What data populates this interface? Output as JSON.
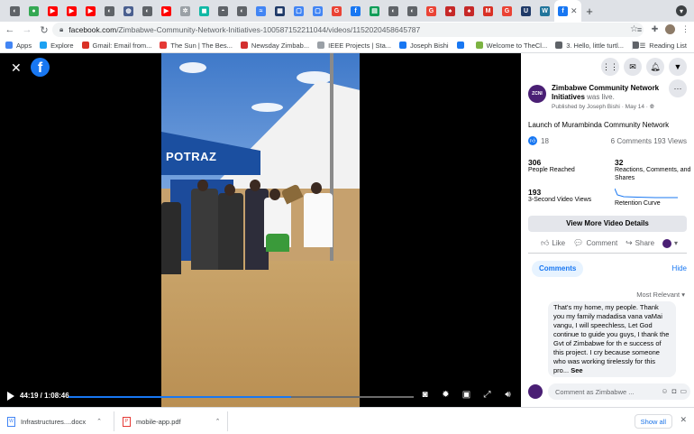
{
  "browser": {
    "tab_icons": [
      {
        "icon": "chrome-icon",
        "color": "#5f6368",
        "glyph": "◐"
      },
      {
        "icon": "green-app-icon",
        "color": "#34a853",
        "glyph": "●"
      },
      {
        "icon": "youtube-icon",
        "color": "#ff0000",
        "glyph": "▶"
      },
      {
        "icon": "youtube-icon",
        "color": "#ff0000",
        "glyph": "▶"
      },
      {
        "icon": "youtube-icon",
        "color": "#ff0000",
        "glyph": "▶"
      },
      {
        "icon": "chrome-icon",
        "color": "#5f6368",
        "glyph": "◐"
      },
      {
        "icon": "globe-icon",
        "color": "#4a5f8f",
        "glyph": "◍"
      },
      {
        "icon": "chrome-icon",
        "color": "#5f6368",
        "glyph": "◐"
      },
      {
        "icon": "youtube-icon",
        "color": "#ff0000",
        "glyph": "▶"
      },
      {
        "icon": "settings-icon",
        "color": "#9aa0a6",
        "glyph": "✲"
      },
      {
        "icon": "teal-app-icon",
        "color": "#10b8a5",
        "glyph": "◼"
      },
      {
        "icon": "hat-icon",
        "color": "#5f6368",
        "glyph": "◓"
      },
      {
        "icon": "chrome-icon",
        "color": "#5f6368",
        "glyph": "◐"
      },
      {
        "icon": "wave-icon",
        "color": "#4285f4",
        "glyph": "≈"
      },
      {
        "icon": "news-icon",
        "color": "#1f3a68",
        "glyph": "▦"
      },
      {
        "icon": "frame-icon",
        "color": "#4285f4",
        "glyph": "▢"
      },
      {
        "icon": "frame-icon",
        "color": "#4285f4",
        "glyph": "▢"
      },
      {
        "icon": "google-icon",
        "color": "#ea4335",
        "glyph": "G"
      },
      {
        "icon": "facebook-icon",
        "color": "#1877f2",
        "glyph": "f"
      },
      {
        "icon": "sheets-icon",
        "color": "#0f9d58",
        "glyph": "▤"
      },
      {
        "icon": "chrome-icon",
        "color": "#5f6368",
        "glyph": "◐"
      },
      {
        "icon": "chrome-icon",
        "color": "#5f6368",
        "glyph": "◐"
      },
      {
        "icon": "google-icon",
        "color": "#ea4335",
        "glyph": "G"
      },
      {
        "icon": "bookmark-red-icon",
        "color": "#c62828",
        "glyph": "♠"
      },
      {
        "icon": "bookmark-red-icon",
        "color": "#c62828",
        "glyph": "♠"
      },
      {
        "icon": "gmail-icon",
        "color": "#d93025",
        "glyph": "M"
      },
      {
        "icon": "google-icon",
        "color": "#ea4335",
        "glyph": "G"
      },
      {
        "icon": "ut-icon",
        "color": "#1f3a68",
        "glyph": "U"
      },
      {
        "icon": "wordpress-icon",
        "color": "#21759b",
        "glyph": "W"
      }
    ],
    "active_tab": {
      "icon": "facebook-icon",
      "close": "✕",
      "color": "#1877f2",
      "glyph": "f"
    },
    "new_tab_glyph": "+",
    "url_host": "facebook.com",
    "url_path": "/Zimbabwe-Community-Network-Initiatives-100587152211044/videos/1152020458645787",
    "reading_list": "Reading List",
    "bookmarks": [
      {
        "label": "Apps",
        "color": "#4285f4"
      },
      {
        "label": "Explore",
        "color": "#1da1f2"
      },
      {
        "label": "Gmail: Email from...",
        "color": "#d93025"
      },
      {
        "label": "The Sun | The Bes...",
        "color": "#e53935"
      },
      {
        "label": "Newsday Zimbab...",
        "color": "#d32f2f"
      },
      {
        "label": "IEEE Projects | Sta...",
        "color": "#9aa0a6"
      },
      {
        "label": "Joseph Bishi",
        "color": "#1877f2"
      },
      {
        "label": "",
        "color": "#1877f2"
      },
      {
        "label": "Welcome to TheCl...",
        "color": "#7cb342"
      },
      {
        "label": "3. Hello, little turtl...",
        "color": "#5f6368"
      },
      {
        "label": "",
        "color": "#5f6368"
      }
    ]
  },
  "video": {
    "banner_text": "POTRAZ",
    "time": "44:19 / 1:08:46",
    "progress": 0.644
  },
  "panel": {
    "page_avatar_text": "ZCNI",
    "page_name": "Zimbabwe Community Network Initiatives",
    "was_live": "was live.",
    "published_by": "Published by Joseph Bishi",
    "date": "May 14",
    "post_title": "Launch of Murambinda Community Network",
    "like_count": "18",
    "comments_count": "6 Comments",
    "views_count": "193 Views",
    "stats": {
      "reached": "306",
      "reached_label": "People Reached",
      "reactions": "32",
      "reactions_label": "Reactions, Comments, and Shares",
      "three_sec": "193",
      "three_sec_label": "3-Second Video Views",
      "retention_label": "Retention Curve"
    },
    "view_more": "View More Video Details",
    "actions": {
      "like": "Like",
      "comment": "Comment",
      "share": "Share"
    },
    "comments_tab": "Comments",
    "hide": "Hide",
    "most_relevant": "Most Relevant",
    "comment_text": "That's my home, my people. Thank you my family madadisa vana vaMai vangu, I will speechless, Let God continue to guide you guys, I thank the Gvt of Zimbabwe for th e success of this project. I cry because someone who was working tirelessly for this pro...",
    "see_more": "See",
    "comment_placeholder": "Comment as Zimbabwe ..."
  },
  "downloads": {
    "items": [
      {
        "name": "Infrastructures....docx",
        "icon": "docx-icon"
      },
      {
        "name": "mobile-app.pdf",
        "icon": "pdf-icon"
      }
    ],
    "show_all": "Show all"
  }
}
